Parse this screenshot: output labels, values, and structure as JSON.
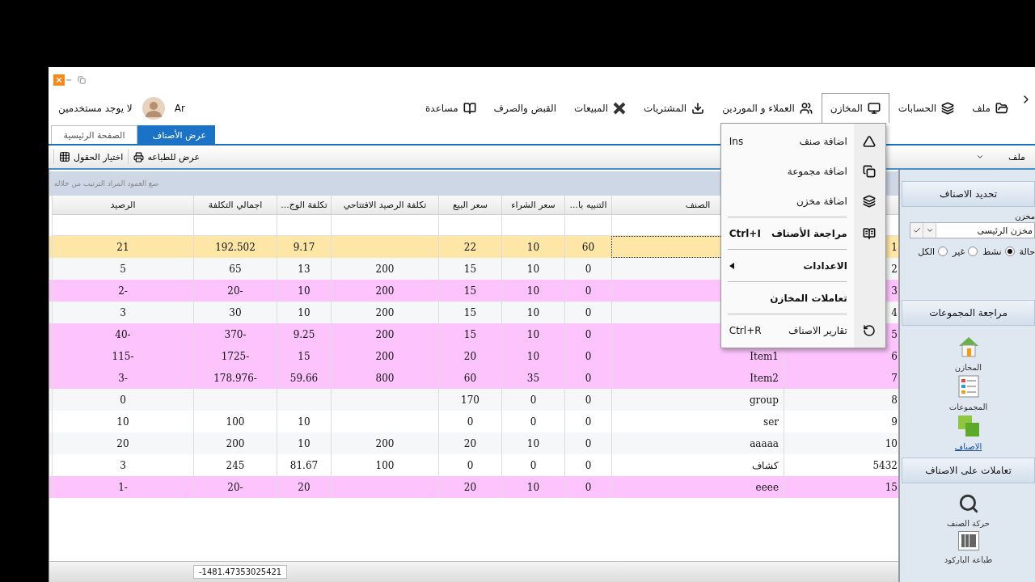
{
  "window": {
    "user_label": "لا يوجد مستخدمين",
    "language": "Ar"
  },
  "menu_bar": [
    {
      "label": "ملف",
      "open": false
    },
    {
      "label": "الحسابات",
      "open": false
    },
    {
      "label": "المخازن",
      "open": true
    },
    {
      "label": "العملاء و الموردين",
      "open": false
    },
    {
      "label": "المشتريات",
      "open": false
    },
    {
      "label": "المبيعات",
      "open": false
    },
    {
      "label": "القبض والصرف",
      "open": false
    },
    {
      "label": "مساعدة",
      "open": false
    }
  ],
  "dropdown": [
    {
      "kind": "item",
      "label": "اضافة صنف",
      "shortcut": "Ins",
      "bold": false
    },
    {
      "kind": "item",
      "label": "اضافة مجموعة",
      "bold": false
    },
    {
      "kind": "item",
      "label": "اضافة مخزن",
      "bold": false
    },
    {
      "kind": "separator"
    },
    {
      "kind": "item",
      "label": "مراجعة الأصناف",
      "shortcut": "Ctrl+I",
      "bold": true
    },
    {
      "kind": "separator"
    },
    {
      "kind": "submenu",
      "label": "الاعدادات",
      "bold": true
    },
    {
      "kind": "separator"
    },
    {
      "kind": "item",
      "label": "تعاملات المخازن",
      "bold": true
    },
    {
      "kind": "separator"
    },
    {
      "kind": "item",
      "label": "تقارير الاصناف",
      "shortcut": "Ctrl+R",
      "bold": false
    }
  ],
  "tabs": [
    {
      "label": "عرض الأصناف",
      "selected": true
    },
    {
      "label": "الصفحة الرئيسية",
      "selected": false
    }
  ],
  "toolbar": {
    "file_menu": "ملف",
    "buttons": [
      "عرض للطباعه",
      "اختيار الحقول"
    ]
  },
  "group_hint": "ضع العمود المراد الترتيب من خلاله",
  "table": {
    "columns": [
      "الصنف",
      "التنبيه با...",
      "سعر الشراء",
      "سعر البيع",
      "تكلفة الرصيد الافتتاحي",
      "تكلفة الوج...",
      "اجمالي التكلفة",
      "الرصيد"
    ],
    "rows": [
      {
        "code": "1",
        "cells": [
          null,
          "60",
          "10",
          "22",
          null,
          "9.17",
          "192.502",
          "21"
        ],
        "selected": true,
        "highlight": false
      },
      {
        "code": "2",
        "cells": [
          null,
          "0",
          "10",
          "15",
          "200",
          "13",
          "65",
          "5"
        ],
        "selected": false,
        "highlight": false
      },
      {
        "code": "3",
        "cells": [
          null,
          "0",
          "10",
          "15",
          "200",
          "10",
          "-20",
          "-2"
        ],
        "selected": false,
        "highlight": true
      },
      {
        "code": "4",
        "cells": [
          null,
          "0",
          "10",
          "15",
          "200",
          "10",
          "30",
          "3"
        ],
        "selected": false,
        "highlight": false
      },
      {
        "code": "5",
        "cells": [
          null,
          "0",
          "10",
          "15",
          "200",
          "9.25",
          "-370",
          "-40"
        ],
        "selected": false,
        "highlight": true
      },
      {
        "code": "6",
        "cells": [
          "Item1",
          "0",
          "10",
          "20",
          "200",
          "15",
          "-1725",
          "-115"
        ],
        "selected": false,
        "highlight": true
      },
      {
        "code": "7",
        "cells": [
          "Item2",
          "0",
          "35",
          "60",
          "800",
          "59.66",
          "-178.976",
          "-3"
        ],
        "selected": false,
        "highlight": true
      },
      {
        "code": "8",
        "cells": [
          "group",
          "0",
          "0",
          "170",
          null,
          null,
          null,
          "0"
        ],
        "selected": false,
        "highlight": false
      },
      {
        "code": "9",
        "cells": [
          "ser",
          "0",
          "0",
          "0",
          null,
          "10",
          "100",
          "10"
        ],
        "selected": false,
        "highlight": false
      },
      {
        "code": "10",
        "cells": [
          "aaaaa",
          "0",
          "10",
          "20",
          "200",
          "10",
          "200",
          "20"
        ],
        "selected": false,
        "highlight": false
      },
      {
        "code": "5432",
        "cells": [
          "كشاف",
          "0",
          "0",
          "0",
          "100",
          "81.67",
          "245",
          "3"
        ],
        "selected": false,
        "highlight": false
      },
      {
        "code": "15",
        "cells": [
          "eeee",
          "0",
          "10",
          "20",
          null,
          "20",
          "-20",
          "-1"
        ],
        "selected": false,
        "highlight": true
      }
    ],
    "total": "-1481.47353025421"
  },
  "side_panel": {
    "sections": [
      {
        "kind": "filter",
        "title": "تحديد الاصناف",
        "store_label": "مخزن",
        "store_value": "مخزن الرئيسى",
        "status_label": "حالة",
        "radios": [
          {
            "label": "نشط",
            "selected": true
          },
          {
            "label": "غير",
            "selected": false
          },
          {
            "label": "الكل",
            "selected": false
          }
        ]
      },
      {
        "kind": "links",
        "title": "مراجعة المجموعات",
        "items": [
          {
            "label": "المخازن",
            "selected": false
          },
          {
            "label": "المجموعات",
            "selected": false
          },
          {
            "label": "الاصناف",
            "selected": true
          }
        ]
      },
      {
        "kind": "links",
        "title": "تعاملات على الاصناف",
        "items": [
          {
            "label": "حركة الصنف",
            "selected": false
          },
          {
            "label": "طباعة الباركود",
            "selected": false
          }
        ]
      }
    ]
  }
}
